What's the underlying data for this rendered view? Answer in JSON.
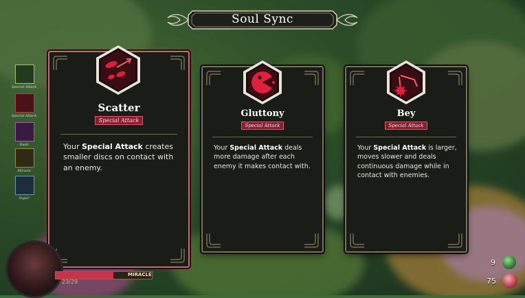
{
  "header": {
    "title": "Soul Sync"
  },
  "cards": [
    {
      "name": "Scatter",
      "tag": "Special Attack",
      "desc_pre": "Your ",
      "desc_bold": "Special Attack",
      "desc_post": " creates smaller discs on contact with an enemy.",
      "icon": "scatter-discs-icon",
      "selected": true
    },
    {
      "name": "Gluttony",
      "tag": "Special Attack",
      "desc_pre": "Your ",
      "desc_bold": "Special Attack",
      "desc_post": " deals more damage after each enemy it makes contact with.",
      "icon": "gluttony-chomper-icon",
      "selected": false
    },
    {
      "name": "Bey",
      "tag": "Special Attack",
      "desc_pre": "Your ",
      "desc_bold": "Special Attack",
      "desc_post": " is larger, moves slower and deals continuous damage while in contact with enemies.",
      "icon": "bey-spinning-blade-icon",
      "selected": false
    }
  ],
  "sidebar": {
    "items": [
      {
        "label": "Special Attack",
        "icon": "special-attack-icon"
      },
      {
        "label": "Special Attack",
        "icon": "special-attack-disc-icon"
      },
      {
        "label": "Dash",
        "icon": "dash-icon"
      },
      {
        "label": "Miracle",
        "icon": "miracle-icon"
      },
      {
        "label": "Super",
        "icon": "super-icon"
      }
    ]
  },
  "hud": {
    "hp": "23/29",
    "miracle_label": "MIRACLE"
  },
  "resources": [
    {
      "value": "9",
      "icon": "green-gem-icon"
    },
    {
      "value": "75",
      "icon": "red-orb-icon"
    }
  ],
  "colors": {
    "accent": "#8a1e30",
    "selected_border": "#c46a74",
    "card_bg": "#1a1d17",
    "frame": "#7c7160"
  }
}
